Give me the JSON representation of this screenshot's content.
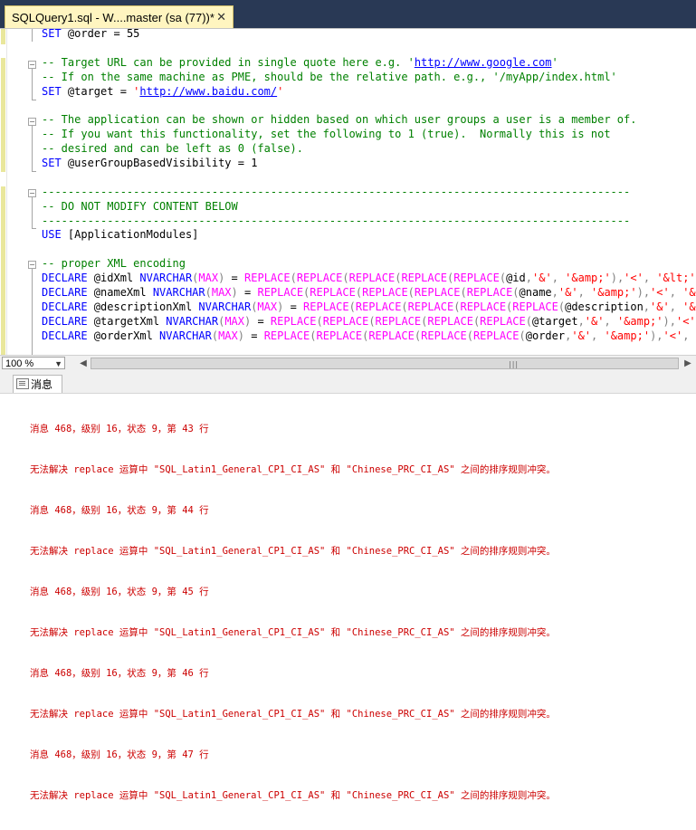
{
  "tab": {
    "title": "SQLQuery1.sql - W....master (sa (77))*",
    "close": "✕"
  },
  "editor": {
    "lines": [
      [
        {
          "c": "kw",
          "t": "SET "
        },
        {
          "c": "var",
          "t": "@order"
        },
        {
          "c": "",
          "t": " = 55"
        }
      ],
      [],
      [
        {
          "c": "cm",
          "t": "-- Target URL can be provided in single quote here e.g. '"
        },
        {
          "c": "cm url",
          "t": "http://www.google.com"
        },
        {
          "c": "cm",
          "t": "'"
        }
      ],
      [
        {
          "c": "cm",
          "t": "-- If on the same machine as PME, should be the relative path. e.g., '/myApp/index.html'"
        }
      ],
      [
        {
          "c": "kw",
          "t": "SET "
        },
        {
          "c": "var",
          "t": "@target"
        },
        {
          "c": "",
          "t": " = "
        },
        {
          "c": "str",
          "t": "'"
        },
        {
          "c": "str url",
          "t": "http://www.baidu.com/"
        },
        {
          "c": "str",
          "t": "'"
        }
      ],
      [],
      [
        {
          "c": "cm",
          "t": "-- The application can be shown or hidden based on which user groups a user is a member of."
        }
      ],
      [
        {
          "c": "cm",
          "t": "-- If you want this functionality, set the following to 1 (true).  Normally this is not"
        }
      ],
      [
        {
          "c": "cm",
          "t": "-- desired and can be left as 0 (false)."
        }
      ],
      [
        {
          "c": "kw",
          "t": "SET "
        },
        {
          "c": "var",
          "t": "@userGroupBasedVisibility"
        },
        {
          "c": "",
          "t": " = 1"
        }
      ],
      [],
      [
        {
          "c": "cm",
          "t": "------------------------------------------------------------------------------------------"
        }
      ],
      [
        {
          "c": "cm",
          "t": "-- DO NOT MODIFY CONTENT BELOW"
        }
      ],
      [
        {
          "c": "cm",
          "t": "------------------------------------------------------------------------------------------"
        }
      ],
      [
        {
          "c": "kw",
          "t": "USE "
        },
        {
          "c": "",
          "t": "[ApplicationModules]"
        }
      ],
      [],
      [
        {
          "c": "cm",
          "t": "-- proper XML encoding"
        }
      ],
      [
        {
          "c": "kw",
          "t": "DECLARE "
        },
        {
          "c": "var",
          "t": "@idXml "
        },
        {
          "c": "kw",
          "t": "NVARCHAR"
        },
        {
          "c": "gr",
          "t": "("
        },
        {
          "c": "fn",
          "t": "MAX"
        },
        {
          "c": "gr",
          "t": ")"
        },
        {
          "c": "",
          "t": " = "
        },
        {
          "c": "fn",
          "t": "REPLACE"
        },
        {
          "c": "gr",
          "t": "("
        },
        {
          "c": "fn",
          "t": "REPLACE"
        },
        {
          "c": "gr",
          "t": "("
        },
        {
          "c": "fn",
          "t": "REPLACE"
        },
        {
          "c": "gr",
          "t": "("
        },
        {
          "c": "fn",
          "t": "REPLACE"
        },
        {
          "c": "gr",
          "t": "("
        },
        {
          "c": "fn",
          "t": "REPLACE"
        },
        {
          "c": "gr",
          "t": "("
        },
        {
          "c": "var",
          "t": "@id"
        },
        {
          "c": "gr",
          "t": ","
        },
        {
          "c": "str",
          "t": "'&'"
        },
        {
          "c": "gr",
          "t": ", "
        },
        {
          "c": "str",
          "t": "'&amp;'"
        },
        {
          "c": "gr",
          "t": "),"
        },
        {
          "c": "str",
          "t": "'<'"
        },
        {
          "c": "gr",
          "t": ", "
        },
        {
          "c": "str",
          "t": "'&lt;'"
        },
        {
          "c": "gr",
          "t": "),'"
        }
      ],
      [
        {
          "c": "kw",
          "t": "DECLARE "
        },
        {
          "c": "var",
          "t": "@nameXml "
        },
        {
          "c": "kw",
          "t": "NVARCHAR"
        },
        {
          "c": "gr",
          "t": "("
        },
        {
          "c": "fn",
          "t": "MAX"
        },
        {
          "c": "gr",
          "t": ")"
        },
        {
          "c": "",
          "t": " = "
        },
        {
          "c": "fn",
          "t": "REPLACE"
        },
        {
          "c": "gr",
          "t": "("
        },
        {
          "c": "fn",
          "t": "REPLACE"
        },
        {
          "c": "gr",
          "t": "("
        },
        {
          "c": "fn",
          "t": "REPLACE"
        },
        {
          "c": "gr",
          "t": "("
        },
        {
          "c": "fn",
          "t": "REPLACE"
        },
        {
          "c": "gr",
          "t": "("
        },
        {
          "c": "fn",
          "t": "REPLACE"
        },
        {
          "c": "gr",
          "t": "("
        },
        {
          "c": "var",
          "t": "@name"
        },
        {
          "c": "gr",
          "t": ","
        },
        {
          "c": "str",
          "t": "'&'"
        },
        {
          "c": "gr",
          "t": ", "
        },
        {
          "c": "str",
          "t": "'&amp;'"
        },
        {
          "c": "gr",
          "t": "),"
        },
        {
          "c": "str",
          "t": "'<'"
        },
        {
          "c": "gr",
          "t": ", "
        },
        {
          "c": "str",
          "t": "'&lt;"
        }
      ],
      [
        {
          "c": "kw",
          "t": "DECLARE "
        },
        {
          "c": "var",
          "t": "@descriptionXml "
        },
        {
          "c": "kw",
          "t": "NVARCHAR"
        },
        {
          "c": "gr",
          "t": "("
        },
        {
          "c": "fn",
          "t": "MAX"
        },
        {
          "c": "gr",
          "t": ")"
        },
        {
          "c": "",
          "t": " = "
        },
        {
          "c": "fn",
          "t": "REPLACE"
        },
        {
          "c": "gr",
          "t": "("
        },
        {
          "c": "fn",
          "t": "REPLACE"
        },
        {
          "c": "gr",
          "t": "("
        },
        {
          "c": "fn",
          "t": "REPLACE"
        },
        {
          "c": "gr",
          "t": "("
        },
        {
          "c": "fn",
          "t": "REPLACE"
        },
        {
          "c": "gr",
          "t": "("
        },
        {
          "c": "fn",
          "t": "REPLACE"
        },
        {
          "c": "gr",
          "t": "("
        },
        {
          "c": "var",
          "t": "@description"
        },
        {
          "c": "gr",
          "t": ","
        },
        {
          "c": "str",
          "t": "'&'"
        },
        {
          "c": "gr",
          "t": ", "
        },
        {
          "c": "str",
          "t": "'&amp"
        }
      ],
      [
        {
          "c": "kw",
          "t": "DECLARE "
        },
        {
          "c": "var",
          "t": "@targetXml "
        },
        {
          "c": "kw",
          "t": "NVARCHAR"
        },
        {
          "c": "gr",
          "t": "("
        },
        {
          "c": "fn",
          "t": "MAX"
        },
        {
          "c": "gr",
          "t": ")"
        },
        {
          "c": "",
          "t": " = "
        },
        {
          "c": "fn",
          "t": "REPLACE"
        },
        {
          "c": "gr",
          "t": "("
        },
        {
          "c": "fn",
          "t": "REPLACE"
        },
        {
          "c": "gr",
          "t": "("
        },
        {
          "c": "fn",
          "t": "REPLACE"
        },
        {
          "c": "gr",
          "t": "("
        },
        {
          "c": "fn",
          "t": "REPLACE"
        },
        {
          "c": "gr",
          "t": "("
        },
        {
          "c": "fn",
          "t": "REPLACE"
        },
        {
          "c": "gr",
          "t": "("
        },
        {
          "c": "var",
          "t": "@target"
        },
        {
          "c": "gr",
          "t": ","
        },
        {
          "c": "str",
          "t": "'&'"
        },
        {
          "c": "gr",
          "t": ", "
        },
        {
          "c": "str",
          "t": "'&amp;'"
        },
        {
          "c": "gr",
          "t": "),"
        },
        {
          "c": "str",
          "t": "'<'"
        },
        {
          "c": "gr",
          "t": ", "
        },
        {
          "c": "str",
          "t": "'&"
        }
      ],
      [
        {
          "c": "kw",
          "t": "DECLARE "
        },
        {
          "c": "var",
          "t": "@orderXml "
        },
        {
          "c": "kw",
          "t": "NVARCHAR"
        },
        {
          "c": "gr",
          "t": "("
        },
        {
          "c": "fn",
          "t": "MAX"
        },
        {
          "c": "gr",
          "t": ")"
        },
        {
          "c": "",
          "t": " = "
        },
        {
          "c": "fn",
          "t": "REPLACE"
        },
        {
          "c": "gr",
          "t": "("
        },
        {
          "c": "fn",
          "t": "REPLACE"
        },
        {
          "c": "gr",
          "t": "("
        },
        {
          "c": "fn",
          "t": "REPLACE"
        },
        {
          "c": "gr",
          "t": "("
        },
        {
          "c": "fn",
          "t": "REPLACE"
        },
        {
          "c": "gr",
          "t": "("
        },
        {
          "c": "fn",
          "t": "REPLACE"
        },
        {
          "c": "gr",
          "t": "("
        },
        {
          "c": "var",
          "t": "@order"
        },
        {
          "c": "gr",
          "t": ","
        },
        {
          "c": "str",
          "t": "'&'"
        },
        {
          "c": "gr",
          "t": ", "
        },
        {
          "c": "str",
          "t": "'&amp;'"
        },
        {
          "c": "gr",
          "t": "),"
        },
        {
          "c": "str",
          "t": "'<'"
        },
        {
          "c": "gr",
          "t": ", "
        },
        {
          "c": "str",
          "t": "'&lt"
        }
      ]
    ]
  },
  "zoom": {
    "value": "100 %"
  },
  "results": {
    "tab_label": "消息",
    "messages": [
      "消息 468，级别 16，状态 9，第 43 行",
      "无法解决 replace 运算中 \"SQL_Latin1_General_CP1_CI_AS\" 和 \"Chinese_PRC_CI_AS\" 之间的排序规则冲突。",
      "消息 468，级别 16，状态 9，第 44 行",
      "无法解决 replace 运算中 \"SQL_Latin1_General_CP1_CI_AS\" 和 \"Chinese_PRC_CI_AS\" 之间的排序规则冲突。",
      "消息 468，级别 16，状态 9，第 45 行",
      "无法解决 replace 运算中 \"SQL_Latin1_General_CP1_CI_AS\" 和 \"Chinese_PRC_CI_AS\" 之间的排序规则冲突。",
      "消息 468，级别 16，状态 9，第 46 行",
      "无法解决 replace 运算中 \"SQL_Latin1_General_CP1_CI_AS\" 和 \"Chinese_PRC_CI_AS\" 之间的排序规则冲突。",
      "消息 468，级别 16，状态 9，第 47 行",
      "无法解决 replace 运算中 \"SQL_Latin1_General_CP1_CI_AS\" 和 \"Chinese_PRC_CI_AS\" 之间的排序规则冲突。"
    ]
  },
  "colors": {
    "keyword": "#0000ff",
    "comment": "#008000",
    "string": "#ff0000",
    "function": "#ff00ff",
    "error": "#cc0000",
    "tab_active": "#fff5c0",
    "tabstrip": "#293955"
  }
}
